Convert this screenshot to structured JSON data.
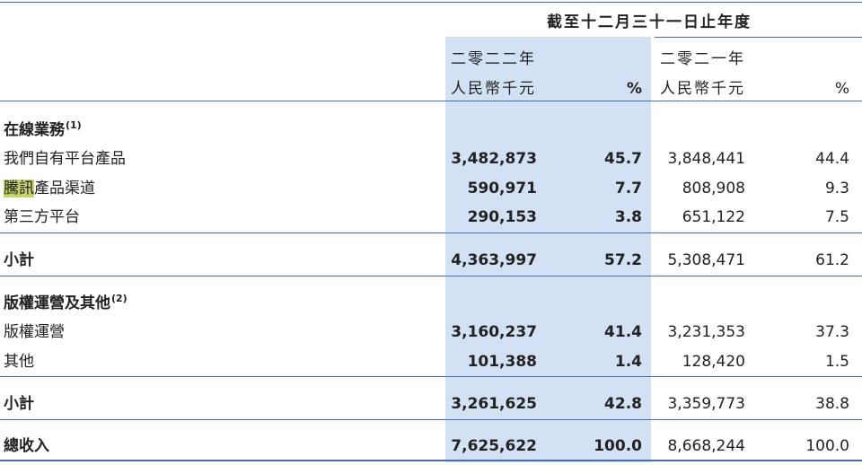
{
  "header": {
    "period": "截至十二月三十一日止年度",
    "year_current": "二零二二年",
    "year_prior": "二零二一年",
    "unit_current": "人民幣千元",
    "unit_prior": "人民幣千元",
    "pct_current": "%",
    "pct_prior": "%"
  },
  "sections": {
    "online": {
      "title": "在線業務",
      "note": "(1)",
      "rows": [
        {
          "label": "我們自有平台產品",
          "v2022": "3,482,873",
          "p2022": "45.7",
          "v2021": "3,848,441",
          "p2021": "44.4"
        },
        {
          "label_mark": "騰訊",
          "label_rest": "產品渠道",
          "v2022": "590,971",
          "p2022": "7.7",
          "v2021": "808,908",
          "p2021": "9.3"
        },
        {
          "label": "第三方平台",
          "v2022": "290,153",
          "p2022": "3.8",
          "v2021": "651,122",
          "p2021": "7.5"
        }
      ],
      "subtotal": {
        "label": "小計",
        "v2022": "4,363,997",
        "p2022": "57.2",
        "v2021": "5,308,471",
        "p2021": "61.2"
      }
    },
    "copyright": {
      "title": "版權運營及其他",
      "note": "(2)",
      "rows": [
        {
          "label": "版權運營",
          "v2022": "3,160,237",
          "p2022": "41.4",
          "v2021": "3,231,353",
          "p2021": "37.3"
        },
        {
          "label": "其他",
          "v2022": "101,388",
          "p2022": "1.4",
          "v2021": "128,420",
          "p2021": "1.5"
        }
      ],
      "subtotal": {
        "label": "小計",
        "v2022": "3,261,625",
        "p2022": "42.8",
        "v2021": "3,359,773",
        "p2021": "38.8"
      }
    }
  },
  "total": {
    "label": "總收入",
    "v2022": "7,625,622",
    "p2022": "100.0",
    "v2021": "8,668,244",
    "p2021": "100.0"
  },
  "colors": {
    "highlight_column": "#d3e1f4",
    "rule": "#4a6fa5",
    "text_mark": "#c9d36e"
  }
}
